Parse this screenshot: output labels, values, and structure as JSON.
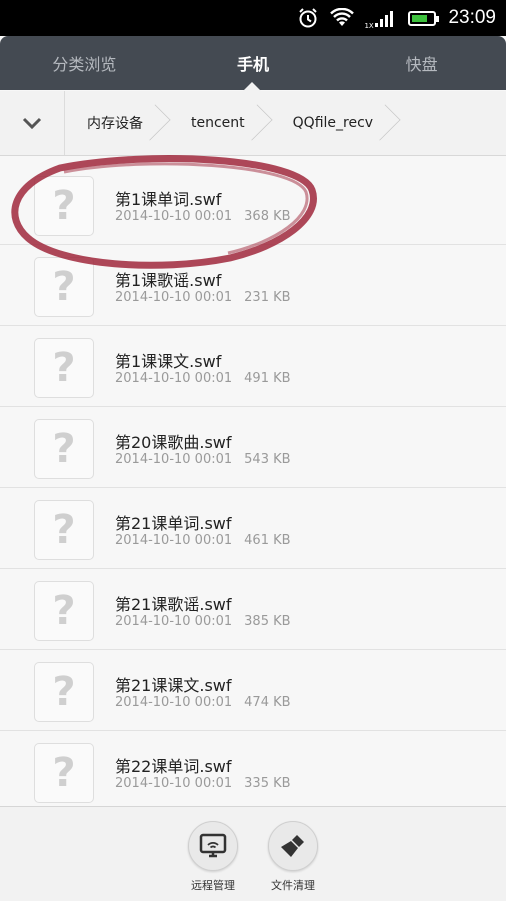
{
  "status_bar": {
    "time": "23:09",
    "network_badge": "1X"
  },
  "tabs": [
    {
      "label": "分类浏览",
      "active": false
    },
    {
      "label": "手机",
      "active": true
    },
    {
      "label": "快盘",
      "active": false
    }
  ],
  "breadcrumb": [
    "内存设备",
    "tencent",
    "QQfile_recv"
  ],
  "files": [
    {
      "name": "第1课单词.swf",
      "date": "2014-10-10 00:01",
      "size": "368 KB",
      "icon": "unknown-file-icon"
    },
    {
      "name": "第1课歌谣.swf",
      "date": "2014-10-10 00:01",
      "size": "231 KB",
      "icon": "unknown-file-icon"
    },
    {
      "name": "第1课课文.swf",
      "date": "2014-10-10 00:01",
      "size": "491 KB",
      "icon": "unknown-file-icon"
    },
    {
      "name": "第20课歌曲.swf",
      "date": "2014-10-10 00:01",
      "size": "543 KB",
      "icon": "unknown-file-icon"
    },
    {
      "name": "第21课单词.swf",
      "date": "2014-10-10 00:01",
      "size": "461 KB",
      "icon": "unknown-file-icon"
    },
    {
      "name": "第21课歌谣.swf",
      "date": "2014-10-10 00:01",
      "size": "385 KB",
      "icon": "unknown-file-icon"
    },
    {
      "name": "第21课课文.swf",
      "date": "2014-10-10 00:01",
      "size": "474 KB",
      "icon": "unknown-file-icon"
    },
    {
      "name": "第22课单词.swf",
      "date": "2014-10-10 00:01",
      "size": "335 KB",
      "icon": "unknown-file-icon"
    }
  ],
  "bottom_actions": [
    {
      "label": "远程管理",
      "icon": "remote-manage-icon"
    },
    {
      "label": "文件清理",
      "icon": "file-clean-icon"
    }
  ],
  "colors": {
    "tab_bar": "#444a52",
    "annotation": "#a0283c",
    "battery": "#3ec13e"
  }
}
